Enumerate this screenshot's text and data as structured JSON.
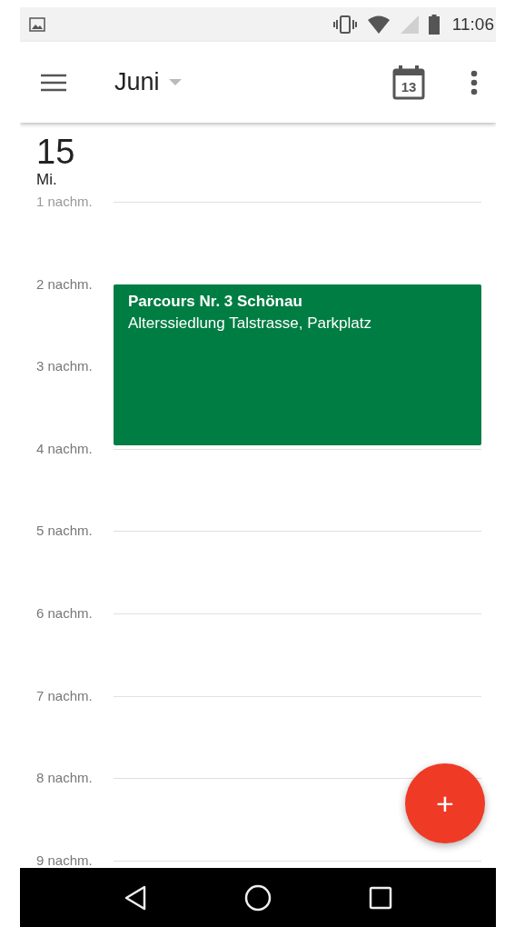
{
  "status_bar": {
    "time": "11:06"
  },
  "toolbar": {
    "title": "Juni",
    "today_day": "13"
  },
  "day": {
    "number": "15",
    "weekday": "Mi."
  },
  "hours": [
    {
      "label": "1 nachm.",
      "faded": true
    },
    {
      "label": "2 nachm.",
      "faded": false
    },
    {
      "label": "3 nachm.",
      "faded": false
    },
    {
      "label": "4 nachm.",
      "faded": false
    },
    {
      "label": "5 nachm.",
      "faded": false
    },
    {
      "label": "6 nachm.",
      "faded": false
    },
    {
      "label": "7 nachm.",
      "faded": false
    },
    {
      "label": "8 nachm.",
      "faded": false
    },
    {
      "label": "9 nachm.",
      "faded": false
    }
  ],
  "events": [
    {
      "title": "Parcours Nr. 3 Schönau",
      "location": "Alterssiedlung Talstrasse, Parkplatz",
      "color": "#007d43"
    }
  ],
  "fab": {
    "label": "+"
  }
}
